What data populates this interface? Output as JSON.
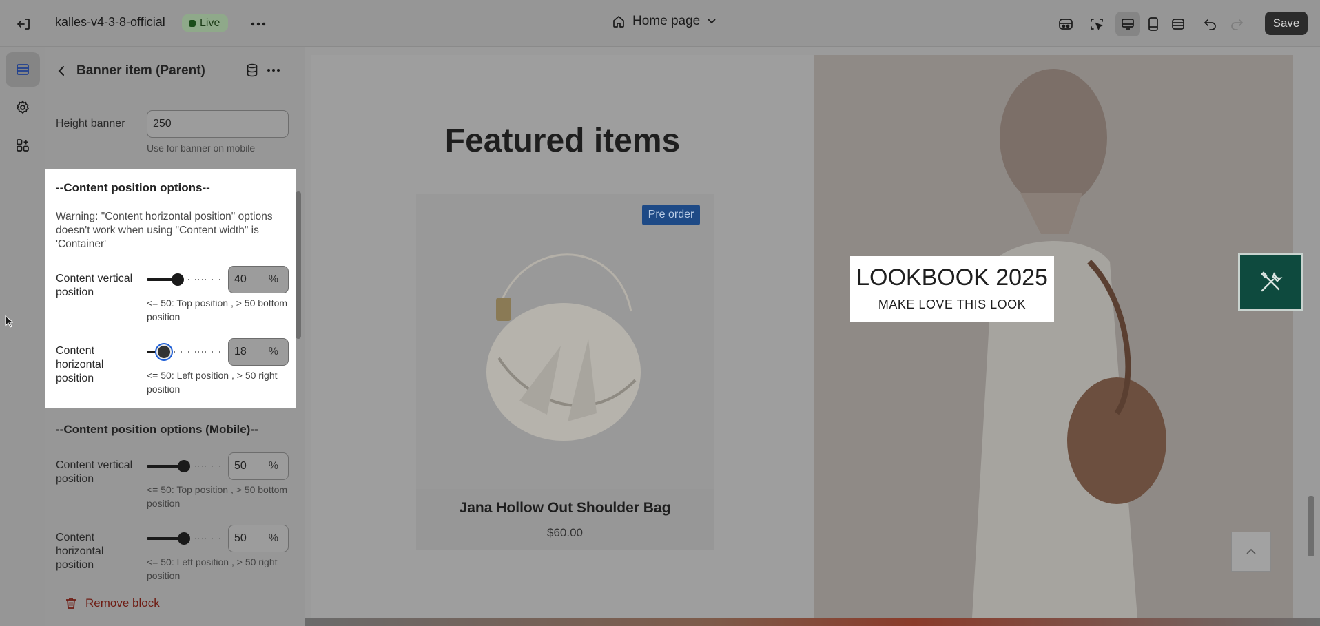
{
  "topbar": {
    "store_name": "kalles-v4-3-8-official",
    "live_badge": "Live",
    "page_selector": "Home page",
    "save_label": "Save"
  },
  "panel": {
    "title": "Banner item (Parent)",
    "height_banner": {
      "label": "Height banner",
      "value": "250",
      "help": "Use for banner on mobile"
    },
    "content_position": {
      "title": "--Content position options--",
      "warning": "Warning: \"Content horizontal position\" options doesn't work when using \"Content width\" is 'Container'",
      "vertical": {
        "label": "Content vertical position",
        "value": "40",
        "value_fraction": 0.4,
        "unit": "%",
        "help": "<= 50: Top position , > 50 bottom position"
      },
      "horizontal": {
        "label": "Content horizontal position",
        "value": "18",
        "value_fraction": 0.18,
        "unit": "%",
        "help": "<= 50: Left position , > 50 right position"
      }
    },
    "content_position_mobile": {
      "title": "--Content position options (Mobile)--",
      "vertical": {
        "label": "Content vertical position",
        "value": "50",
        "value_fraction": 0.5,
        "unit": "%",
        "help": "<= 50: Top position , > 50 bottom position"
      },
      "horizontal": {
        "label": "Content horizontal position",
        "value": "50",
        "value_fraction": 0.5,
        "unit": "%",
        "help": "<= 50: Left position , > 50 right position"
      }
    },
    "remove_block_label": "Remove block"
  },
  "preview": {
    "featured_title": "Featured items",
    "product": {
      "badge": "Pre order",
      "name": "Jana Hollow Out Shoulder Bag",
      "price": "$60.00"
    },
    "lookbook": {
      "title": "LOOKBOOK 2025",
      "subtitle": "MAKE LOVE THIS LOOK"
    }
  },
  "colors": {
    "live_badge": "#8fa98a",
    "preorder_badge": "#1e4a86",
    "tool_button": "#0e4a3e",
    "remove_text": "#6e1b12",
    "focus_ring": "#1f5fd6"
  }
}
